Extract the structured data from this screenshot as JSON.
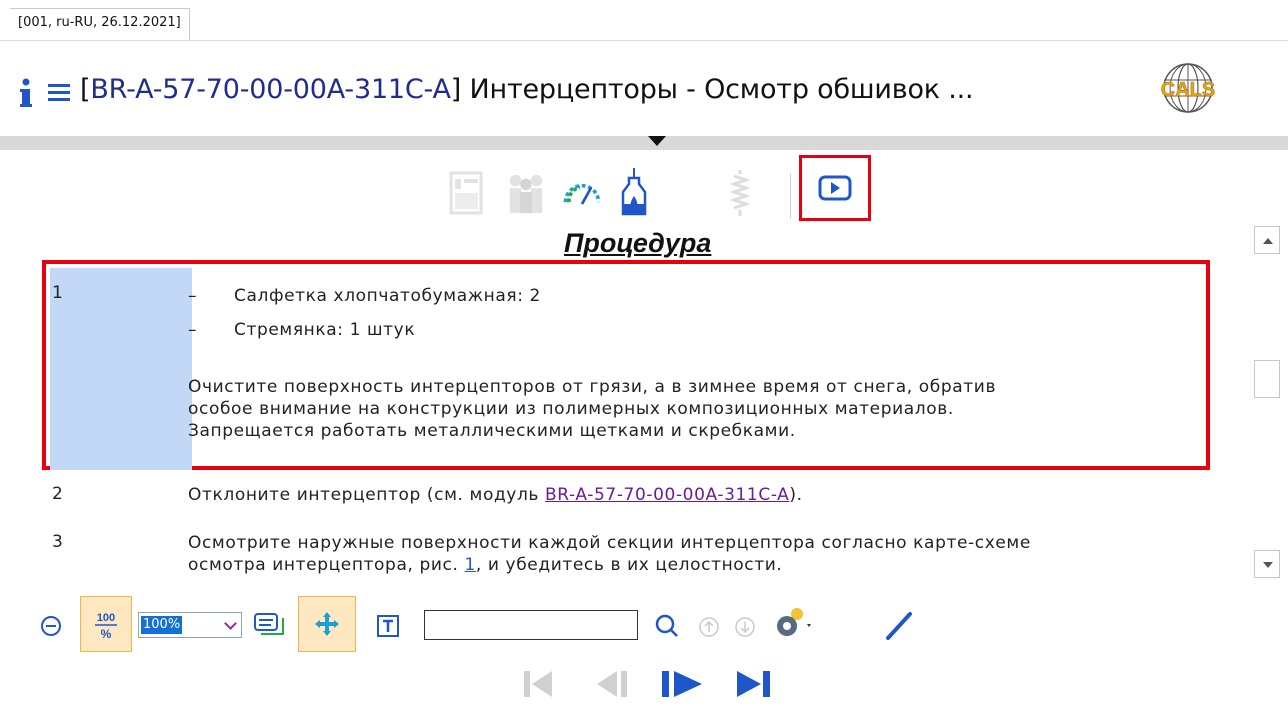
{
  "meta": {
    "tag": "[001, ru-RU, 26.12.2021]"
  },
  "header": {
    "code": "BR-A-57-70-00-00A-311C-A",
    "bracket_open": "[",
    "bracket_close": "]",
    "title_text": " Интерцепторы - Осмотр обшивок ...",
    "logo_text": "CALS"
  },
  "toolbar": {
    "icons": [
      "info-sheet-icon",
      "personnel-icon",
      "gauge-icon",
      "fluid-bottle-icon",
      "spring-icon",
      "video-play-icon"
    ],
    "highlight_color": "#e8000f"
  },
  "section": {
    "heading": "Процедура"
  },
  "steps": [
    {
      "number": "1",
      "items": [
        "Салфетка хлопчатобумажная: 2",
        "Стремянка: 1 штук"
      ],
      "dash": "–",
      "text_lines": [
        "Очистите поверхность интерцепторов от грязи, а в зимнее время от снега, обратив",
        "особое внимание на конструкции из полимерных композиционных материалов.",
        "Запрещается работать металлическими щетками и скребками."
      ]
    },
    {
      "number": "2",
      "text_before": "Отклоните интерцептор (см. модуль ",
      "link": "BR-A-57-70-00-00A-311C-A",
      "text_after": ")."
    },
    {
      "number": "3",
      "line1": "Осмотрите наружные поверхности каждой секции интерцептора согласно карте-схеме",
      "line2_before": "осмотра интерцептора, рис. ",
      "figure_link": "1",
      "line2_after": ", и убедитесь в их целостности."
    }
  ],
  "bottom_toolbar": {
    "zoom_reset_label": "100 %",
    "zoom_value": "100%",
    "search_placeholder": "",
    "accent_color": "#1f56c9"
  },
  "nav": {
    "buttons": [
      "first",
      "previous",
      "next",
      "last"
    ]
  }
}
